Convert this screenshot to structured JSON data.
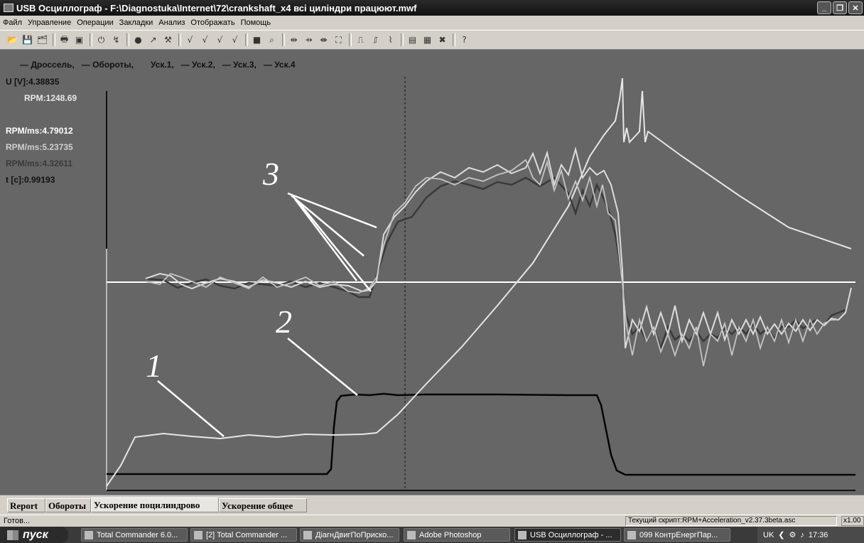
{
  "window": {
    "title": "USB Осциллограф - F:\\Diagnostuka\\Internet\\72\\crankshaft_x4 всі циліндри працюют.mwf",
    "app_icon": "oscilloscope-icon",
    "buttons": [
      "minimize-icon",
      "restore-icon",
      "close-icon"
    ]
  },
  "menu": [
    "Файл",
    "Управление",
    "Операции",
    "Закладки",
    "Анализ",
    "Отображать",
    "Помощь"
  ],
  "toolbar": {
    "icons": [
      "open-folder-icon",
      "save-icon",
      "save-all-icon",
      "separator",
      "print-icon",
      "save-disk-icon",
      "separator",
      "power-icon",
      "auto-icon",
      "separator",
      "record-icon",
      "cursor-icon",
      "tools-icon",
      "separator",
      "check-icon",
      "check-2-icon",
      "check-3-icon",
      "check-4-icon",
      "separator",
      "square-icon",
      "search-icon",
      "separator",
      "arrows-left-icon",
      "arrows-right-icon",
      "arrows-center-icon",
      "fit-icon",
      "separator",
      "signal-icon",
      "signal-2-icon",
      "signal-3-icon",
      "separator",
      "chart-icon",
      "grid-icon",
      "cross-icon",
      "separator",
      "help-icon"
    ]
  },
  "legend": [
    {
      "label": "— Дроссель,"
    },
    {
      "label": "— Обороты,"
    },
    {
      "label": "Уск.1,"
    },
    {
      "label": "— Уск.2,"
    },
    {
      "label": "— Уск.3,"
    },
    {
      "label": "— Уск.4"
    }
  ],
  "readouts": [
    {
      "text": "U [V]:4.38835",
      "color": "#111111"
    },
    {
      "text": "RPM:1248.69",
      "color": "#e8e8e8"
    },
    {
      "text": "",
      "color": "#111111"
    },
    {
      "text": "RPM/ms:4.79012",
      "color": "#ffffff"
    },
    {
      "text": "RPM/ms:5.23735",
      "color": "#cfcfcf"
    },
    {
      "text": "RPM/ms:4.32611",
      "color": "#3a3a3a"
    },
    {
      "text": "t [c]:0.99193",
      "color": "#111111"
    }
  ],
  "annotations": {
    "label1": "1",
    "label2": "2",
    "label3": "3"
  },
  "tabs": [
    {
      "label": "Report",
      "active": false
    },
    {
      "label": "Обороты",
      "active": false
    },
    {
      "label": "Ускорение поцилиндрово",
      "active": true
    },
    {
      "label": "Ускорение общее",
      "active": false
    }
  ],
  "status": {
    "left": "Готов...",
    "script": "Текущий скрипт:RPM+Acceleration_v2.37.3beta.asc",
    "zoom": "x1.00"
  },
  "taskbar": {
    "start": "пуск",
    "tasks": [
      "Total Commander 6.0...",
      "[2] Total Commander ...",
      "ДіагнДвигПоПриско...",
      "Adobe Photoshop",
      "USB Осциллограф - ...",
      "099 КонтрЕнергПар..."
    ],
    "tray_lang": "UK",
    "clock": "17:36"
  }
}
